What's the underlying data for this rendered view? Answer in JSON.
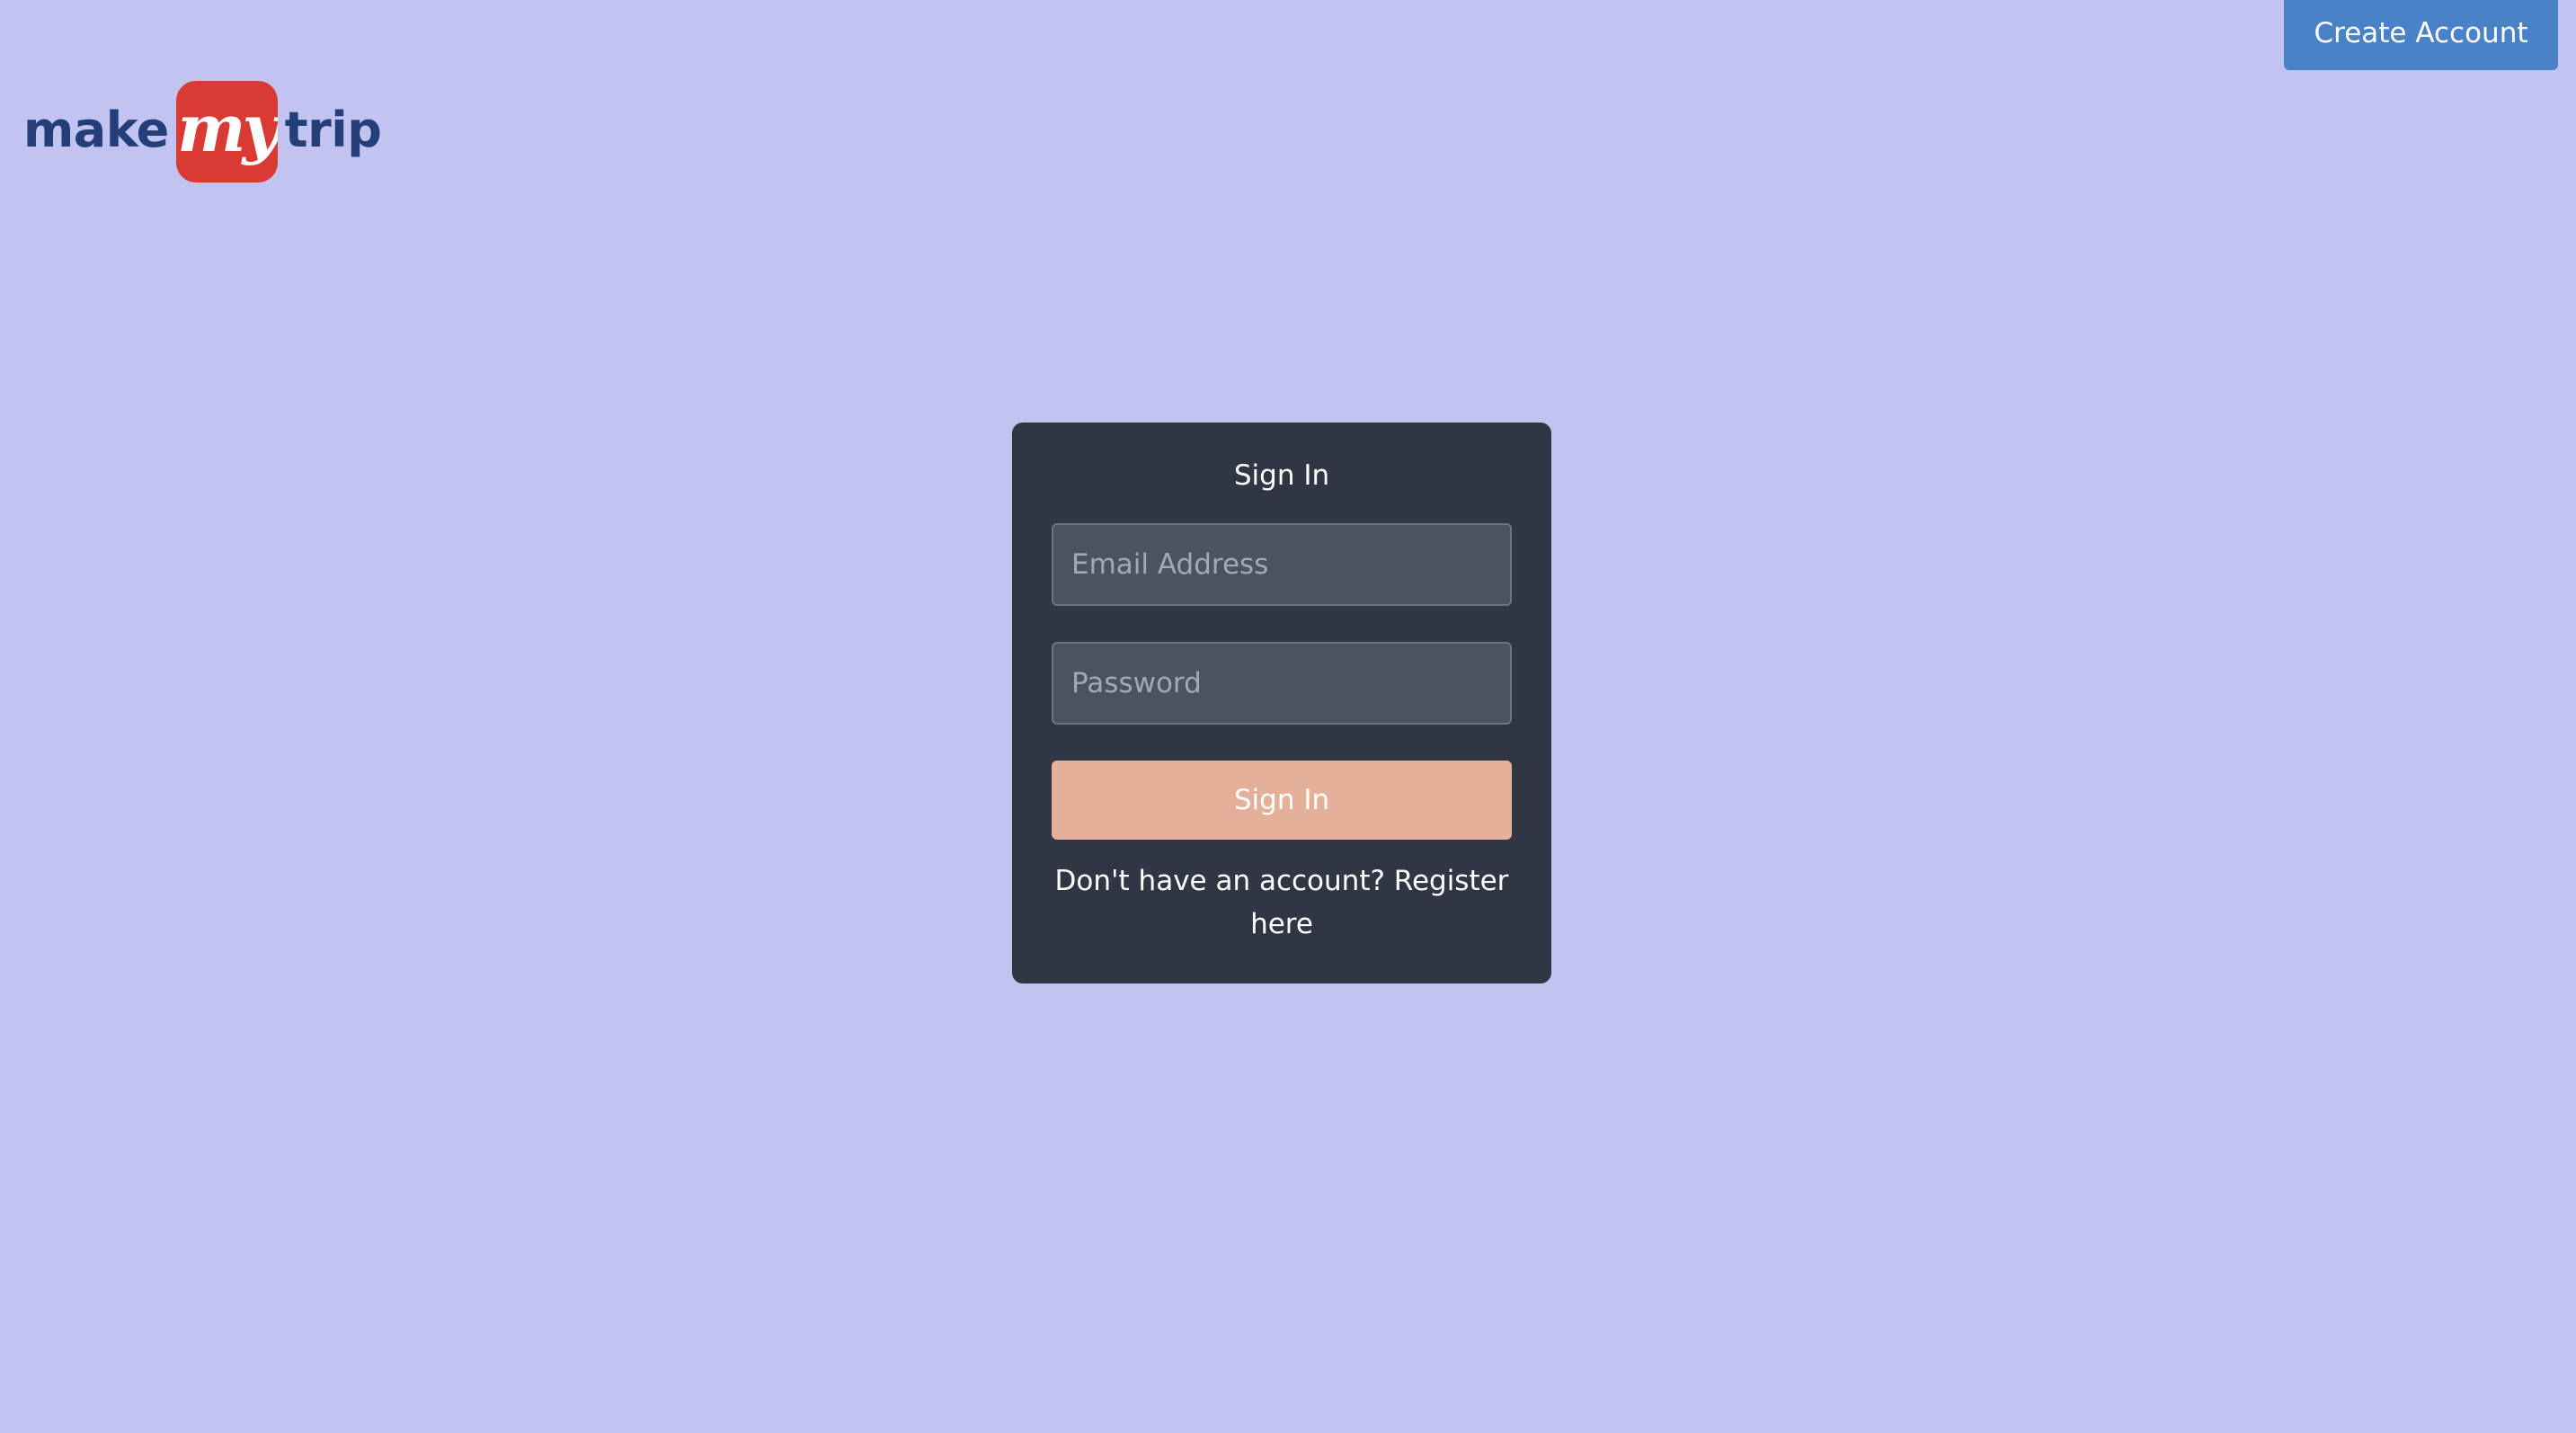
{
  "logo": {
    "make": "make",
    "my": "my",
    "trip": "trip",
    "colors": {
      "text": "#233e79",
      "badge": "#d93b34"
    }
  },
  "header": {
    "create_account_label": "Create Account"
  },
  "signin": {
    "title": "Sign In",
    "email_placeholder": "Email Address",
    "email_value": "",
    "password_placeholder": "Password",
    "password_value": "",
    "button_label": "Sign In",
    "register_prompt": "Don't have an account?",
    "register_link": "Register here"
  },
  "colors": {
    "background": "#c3c3f1",
    "card": "#313645",
    "input": "#4b5262",
    "signin_button": "#e5b09a",
    "create_account_button": "#4a82c8"
  }
}
